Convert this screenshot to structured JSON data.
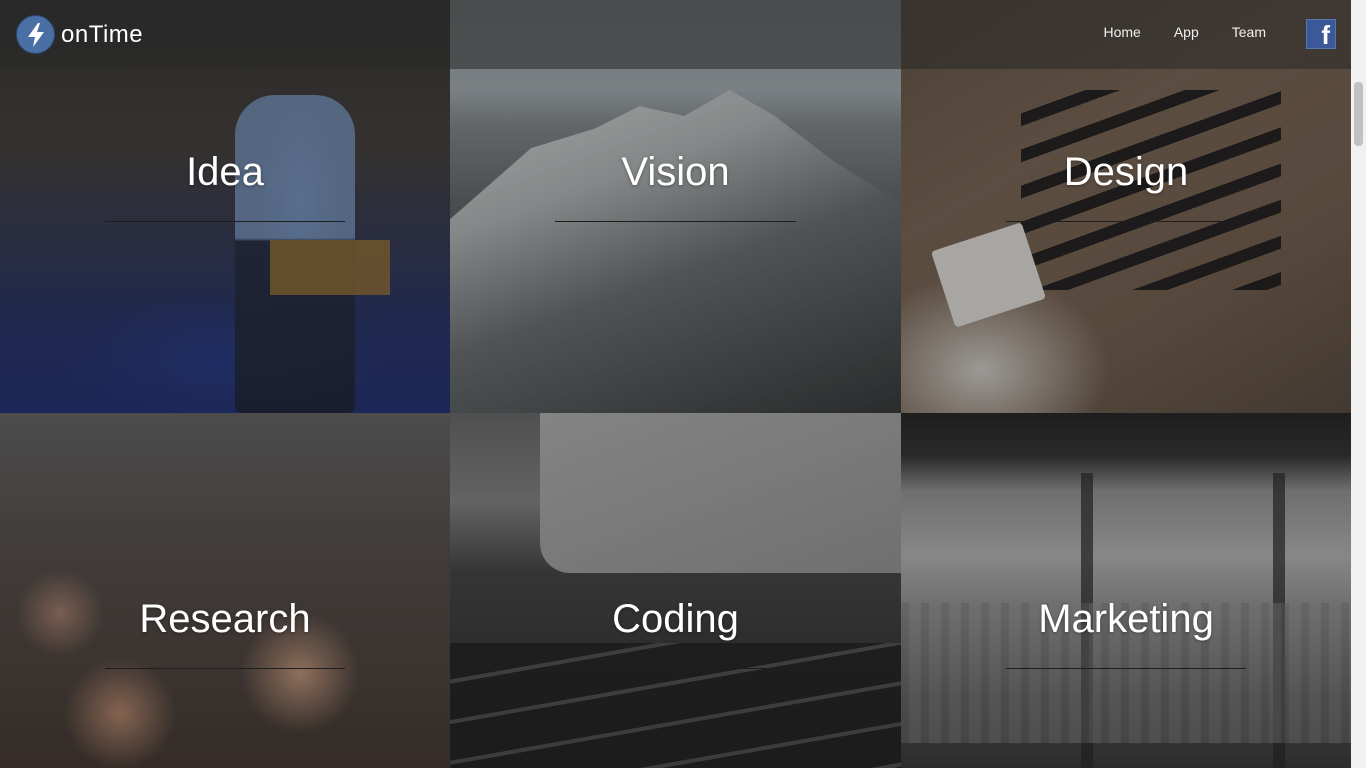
{
  "brand": {
    "name": "onTime"
  },
  "nav": {
    "items": [
      {
        "label": "Home"
      },
      {
        "label": "App"
      },
      {
        "label": "Team"
      }
    ],
    "facebook_glyph": "f"
  },
  "tiles": [
    {
      "label": "Idea"
    },
    {
      "label": "Vision"
    },
    {
      "label": "Design"
    },
    {
      "label": "Research"
    },
    {
      "label": "Coding"
    },
    {
      "label": "Marketing"
    }
  ],
  "colors": {
    "navbar_overlay": "#282828",
    "facebook_blue": "#3b5998",
    "logo_blue": "#4a6fa5",
    "tile_text": "#ffffff"
  },
  "icons": {
    "logo": "lightning-bolt-icon",
    "facebook": "facebook-icon"
  }
}
